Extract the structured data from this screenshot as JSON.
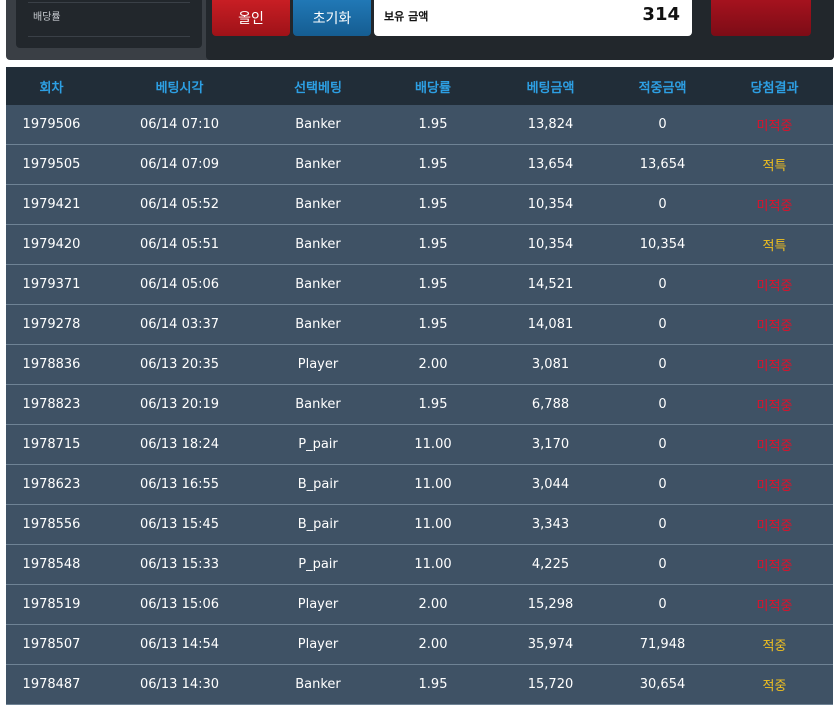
{
  "top": {
    "odds_label": "배당률",
    "allin_label": "올인",
    "reset_label": "초기화",
    "balance_label": "보유 금액",
    "balance_value": "314"
  },
  "table": {
    "headers": [
      "회차",
      "베팅시각",
      "선택베팅",
      "배당률",
      "베팅금액",
      "적중금액",
      "당첨결과"
    ],
    "rows": [
      {
        "round": "1979506",
        "time": "06/14 07:10",
        "pick": "Banker",
        "odds": "1.95",
        "bet": "13,824",
        "win": "0",
        "result": "미적중",
        "status": "lose"
      },
      {
        "round": "1979505",
        "time": "06/14 07:09",
        "pick": "Banker",
        "odds": "1.95",
        "bet": "13,654",
        "win": "13,654",
        "result": "적특",
        "status": "win"
      },
      {
        "round": "1979421",
        "time": "06/14 05:52",
        "pick": "Banker",
        "odds": "1.95",
        "bet": "10,354",
        "win": "0",
        "result": "미적중",
        "status": "lose"
      },
      {
        "round": "1979420",
        "time": "06/14 05:51",
        "pick": "Banker",
        "odds": "1.95",
        "bet": "10,354",
        "win": "10,354",
        "result": "적특",
        "status": "win"
      },
      {
        "round": "1979371",
        "time": "06/14 05:06",
        "pick": "Banker",
        "odds": "1.95",
        "bet": "14,521",
        "win": "0",
        "result": "미적중",
        "status": "lose"
      },
      {
        "round": "1979278",
        "time": "06/14 03:37",
        "pick": "Banker",
        "odds": "1.95",
        "bet": "14,081",
        "win": "0",
        "result": "미적중",
        "status": "lose"
      },
      {
        "round": "1978836",
        "time": "06/13 20:35",
        "pick": "Player",
        "odds": "2.00",
        "bet": "3,081",
        "win": "0",
        "result": "미적중",
        "status": "lose"
      },
      {
        "round": "1978823",
        "time": "06/13 20:19",
        "pick": "Banker",
        "odds": "1.95",
        "bet": "6,788",
        "win": "0",
        "result": "미적중",
        "status": "lose"
      },
      {
        "round": "1978715",
        "time": "06/13 18:24",
        "pick": "P_pair",
        "odds": "11.00",
        "bet": "3,170",
        "win": "0",
        "result": "미적중",
        "status": "lose"
      },
      {
        "round": "1978623",
        "time": "06/13 16:55",
        "pick": "B_pair",
        "odds": "11.00",
        "bet": "3,044",
        "win": "0",
        "result": "미적중",
        "status": "lose"
      },
      {
        "round": "1978556",
        "time": "06/13 15:45",
        "pick": "B_pair",
        "odds": "11.00",
        "bet": "3,343",
        "win": "0",
        "result": "미적중",
        "status": "lose"
      },
      {
        "round": "1978548",
        "time": "06/13 15:33",
        "pick": "P_pair",
        "odds": "11.00",
        "bet": "4,225",
        "win": "0",
        "result": "미적중",
        "status": "lose"
      },
      {
        "round": "1978519",
        "time": "06/13 15:06",
        "pick": "Player",
        "odds": "2.00",
        "bet": "15,298",
        "win": "0",
        "result": "미적중",
        "status": "lose"
      },
      {
        "round": "1978507",
        "time": "06/13 14:54",
        "pick": "Player",
        "odds": "2.00",
        "bet": "35,974",
        "win": "71,948",
        "result": "적중",
        "status": "win"
      },
      {
        "round": "1978487",
        "time": "06/13 14:30",
        "pick": "Banker",
        "odds": "1.95",
        "bet": "15,720",
        "win": "30,654",
        "result": "적중",
        "status": "win"
      }
    ]
  },
  "colors": {
    "header_bg": "#212d38",
    "header_text": "#2d9fe3",
    "row_bg": "#3f5265",
    "win": "#f0c020",
    "lose": "#e0102a"
  }
}
